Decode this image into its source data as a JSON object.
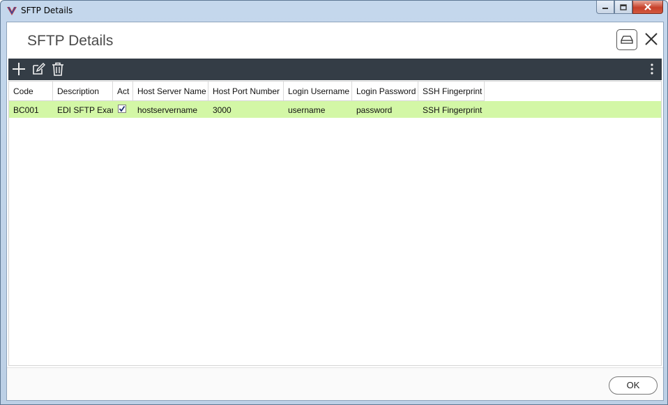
{
  "window": {
    "title": "SFTP Details",
    "controls": [
      "minimize-icon",
      "maximize-icon",
      "close-icon"
    ]
  },
  "header": {
    "title": "SFTP Details",
    "icons": [
      "drive-icon",
      "close-icon"
    ]
  },
  "toolbar": {
    "icons": [
      "add-icon",
      "edit-icon",
      "delete-icon",
      "more-vertical-icon"
    ]
  },
  "grid": {
    "columns": [
      {
        "key": "code",
        "label": "Code"
      },
      {
        "key": "description",
        "label": "Description"
      },
      {
        "key": "active",
        "label": "Act"
      },
      {
        "key": "host_server_name",
        "label": "Host Server Name"
      },
      {
        "key": "host_port_number",
        "label": "Host Port Number"
      },
      {
        "key": "login_username",
        "label": "Login Username"
      },
      {
        "key": "login_password",
        "label": "Login Password"
      },
      {
        "key": "ssh_fingerprint",
        "label": "SSH Fingerprint"
      }
    ],
    "rows": [
      {
        "code": "BC001",
        "description": "EDI SFTP Exar",
        "active": true,
        "host_server_name": "hostservername",
        "host_port_number": "3000",
        "login_username": "username",
        "login_password": "password",
        "ssh_fingerprint": "SSH Fingerprint"
      }
    ],
    "selected_row_color": "#d3f7a6"
  },
  "footer": {
    "ok_label": "OK"
  },
  "colors": {
    "toolbar_bg": "#343d46",
    "frame_bg": "#c4d7ec",
    "close_red": "#c7402a"
  }
}
